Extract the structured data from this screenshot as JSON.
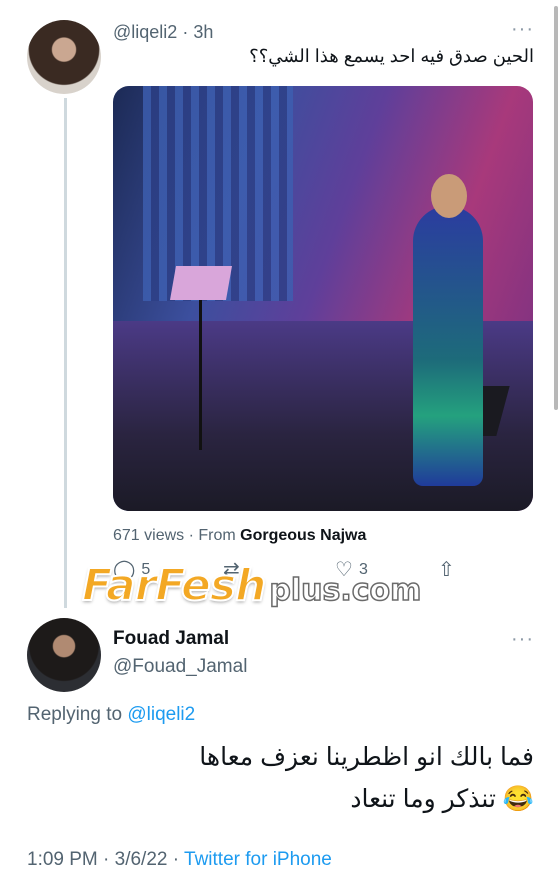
{
  "tweet1": {
    "handle": "@liqeli2",
    "time": "· 3h",
    "text": "الحين صدق فيه احد يسمع هذا الشي؟؟",
    "views": "671 views · From ",
    "source": "Gorgeous Najwa",
    "actions": [
      {
        "icon": "reply-icon",
        "glyph": "◯",
        "count": "5"
      },
      {
        "icon": "retweet-icon",
        "glyph": "⇄",
        "count": ""
      },
      {
        "icon": "heart-icon",
        "glyph": "♡",
        "count": "3"
      },
      {
        "icon": "share-icon",
        "glyph": "⇧",
        "count": ""
      }
    ]
  },
  "watermark": {
    "main": "FarFesh",
    "sub": "plus.com"
  },
  "tweet2": {
    "name": "Fouad Jamal",
    "handle": "@Fouad_Jamal",
    "replying_prefix": "Replying to ",
    "replying_handle": "@liqeli2",
    "text": "فما بالك انو اظطرينا نعزف معاها 😂 تنذكر وما تنعاد",
    "timestamp": "1:09 PM · 3/6/22 · ",
    "client": "Twitter for iPhone"
  },
  "more_glyph": "···",
  "colors": {
    "link": "#1d9bf0",
    "muted": "#536471",
    "watermark": "#f3a824"
  }
}
